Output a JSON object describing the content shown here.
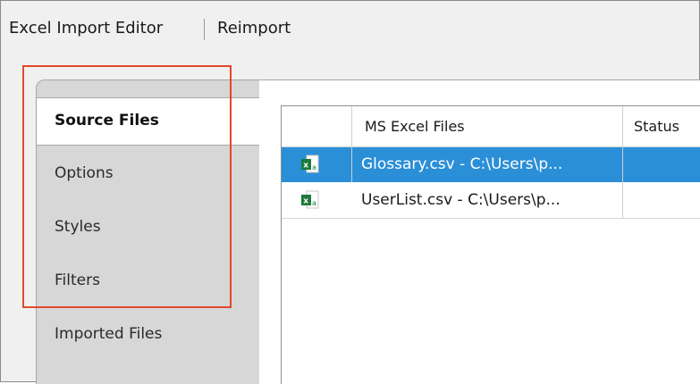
{
  "header": {
    "title": "Excel Import Editor",
    "reimport_label": "Reimport"
  },
  "tabs": [
    {
      "label": "Source Files",
      "active": true
    },
    {
      "label": "Options",
      "active": false
    },
    {
      "label": "Styles",
      "active": false
    },
    {
      "label": "Filters",
      "active": false
    },
    {
      "label": "Imported Files",
      "active": false
    }
  ],
  "grid": {
    "columns": [
      "",
      "MS Excel Files",
      "Status"
    ],
    "rows": [
      {
        "icon": "excel-file-icon",
        "name": "Glossary.csv - C:\\Users\\p...",
        "status": "",
        "selected": true
      },
      {
        "icon": "excel-file-icon",
        "name": "UserList.csv - C:\\Users\\p...",
        "status": "",
        "selected": false
      }
    ]
  },
  "colors": {
    "selection": "#2b8fd8",
    "highlight_box": "#e2482f",
    "excel_green": "#1d7a3a"
  }
}
